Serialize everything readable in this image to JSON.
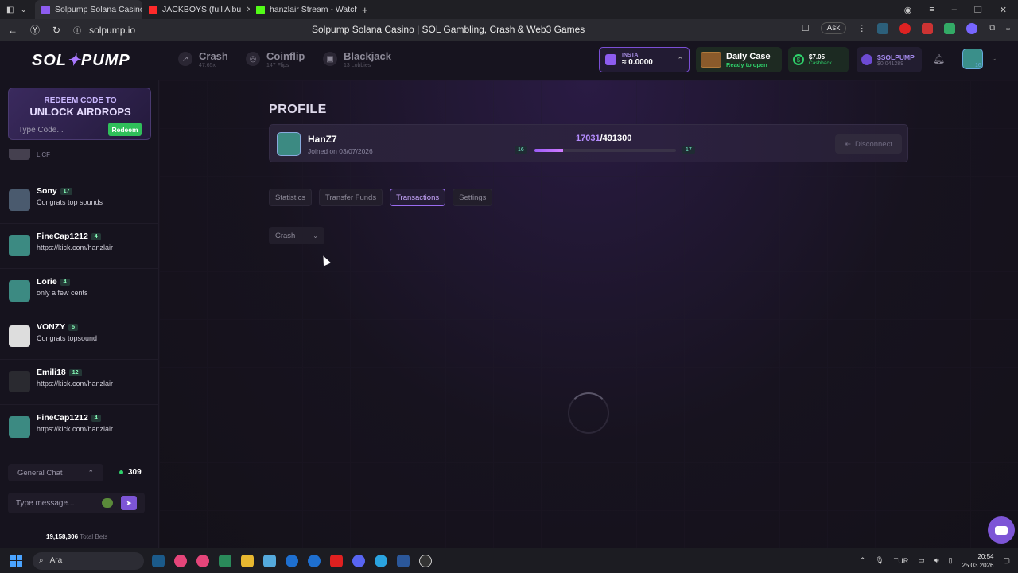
{
  "browser": {
    "tabs": [
      {
        "label": "Solpump Solana Casino",
        "color": "#8d5cf0"
      },
      {
        "label": "JACKBOYS (full Albu",
        "color": "#ff2a2a"
      },
      {
        "label": "hanzlair Stream - Watch Li",
        "color": "#53fc18"
      }
    ],
    "url": "solpump.io",
    "page_title": "Solpump Solana Casino | SOL Gambling, Crash & Web3 Games",
    "ask_label": "Ask"
  },
  "header": {
    "logo_left": "SOL",
    "logo_right": "PUMP",
    "games": [
      {
        "name": "Crash",
        "sub": "47.65x"
      },
      {
        "name": "Coinflip",
        "sub": "147 Flips"
      },
      {
        "name": "Blackjack",
        "sub": "13 Lobbies"
      }
    ],
    "wallet": {
      "label": "INSTA",
      "value": "0.0000"
    },
    "daily_case": {
      "title": "Daily Case",
      "sub": "Ready to open"
    },
    "cashback": {
      "value": "$7.05",
      "sub": "Cashback"
    },
    "token": {
      "value": "$SOLPUMP",
      "sub": "$0.041289"
    },
    "avatar_level": "16"
  },
  "sidebar": {
    "redeem_line1": "REDEEM CODE TO",
    "redeem_line2": "UNLOCK AIRDROPS",
    "code_placeholder": "Type Code...",
    "redeem_button": "Redeem",
    "partial_msg": "L CF",
    "chats": [
      {
        "name": "Sony",
        "level": "17",
        "msg": "Congrats top sounds"
      },
      {
        "name": "FineCap1212",
        "level": "4",
        "msg": "https://kick.com/hanzlair"
      },
      {
        "name": "Lorie",
        "level": "4",
        "msg": "only a few cents"
      },
      {
        "name": "VONZY",
        "level": "5",
        "msg": "Congrats topsound"
      },
      {
        "name": "Emili18",
        "level": "12",
        "msg": "https://kick.com/hanzlair"
      },
      {
        "name": "FineCap1212",
        "level": "4",
        "msg": "https://kick.com/hanzlair"
      }
    ],
    "chat_room": "General Chat",
    "online_count": "309",
    "message_placeholder": "Type message...",
    "total_bets_value": "19,158,306",
    "total_bets_label": "Total Bets"
  },
  "profile": {
    "title": "PROFILE",
    "username": "HanZ7",
    "joined": "Joined on 03/07/2026",
    "xp_current": "17031",
    "xp_total": "/491300",
    "level_current": "16",
    "level_next": "17",
    "xp_progress_fraction": 0.2,
    "disconnect_label": "Disconnect",
    "tabs": [
      "Statistics",
      "Transfer Funds",
      "Transactions",
      "Settings"
    ],
    "active_tab": "Transactions",
    "filter_value": "Crash"
  },
  "taskbar": {
    "search_label": "Ara",
    "lang": "TUR",
    "time": "20:54",
    "date": "25.03.2026"
  }
}
